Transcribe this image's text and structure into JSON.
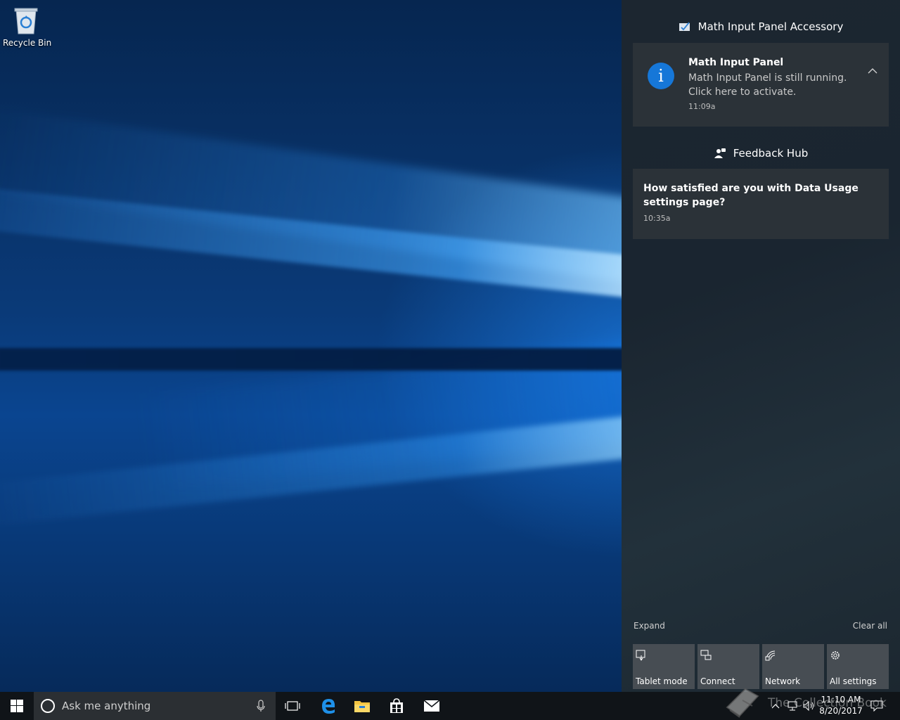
{
  "desktop": {
    "icons": [
      {
        "label": "Recycle Bin",
        "icon": "recycle-bin-icon"
      }
    ]
  },
  "action_center": {
    "groups": [
      {
        "app_name": "Math Input Panel Accessory",
        "icon": "math-input-panel-icon",
        "notification": {
          "title": "Math Input Panel",
          "body": "Math Input Panel is still running. Click here to activate.",
          "body_line1": "Math Input Panel is still running.",
          "body_line2": "Click here to activate.",
          "time": "11:09a",
          "icon": "info-icon",
          "icon_glyph": "i"
        }
      },
      {
        "app_name": "Feedback Hub",
        "icon": "feedback-hub-icon",
        "notification": {
          "title_line1": "How satisfied are you with Data Usage",
          "title_line2": "settings page?",
          "time": "10:35a"
        }
      }
    ],
    "expand_label": "Expand",
    "clear_all_label": "Clear all",
    "quick_actions": [
      {
        "label": "Tablet mode",
        "icon": "tablet-mode-icon"
      },
      {
        "label": "Connect",
        "icon": "connect-icon"
      },
      {
        "label": "Network",
        "icon": "network-icon"
      },
      {
        "label": "All settings",
        "icon": "gear-icon"
      }
    ]
  },
  "taskbar": {
    "search_placeholder": "Ask me anything",
    "pinned": [
      "task-view-icon",
      "edge-icon",
      "file-explorer-icon",
      "store-icon",
      "mail-icon"
    ],
    "clock_time": "11:10 AM",
    "clock_date": "8/20/2017"
  },
  "watermark": "The Collection Book",
  "colors": {
    "accent": "#1677d8",
    "card_bg": "#2b3238",
    "quick_action_bg": "#474d53",
    "taskbar_bg": "#101418"
  }
}
